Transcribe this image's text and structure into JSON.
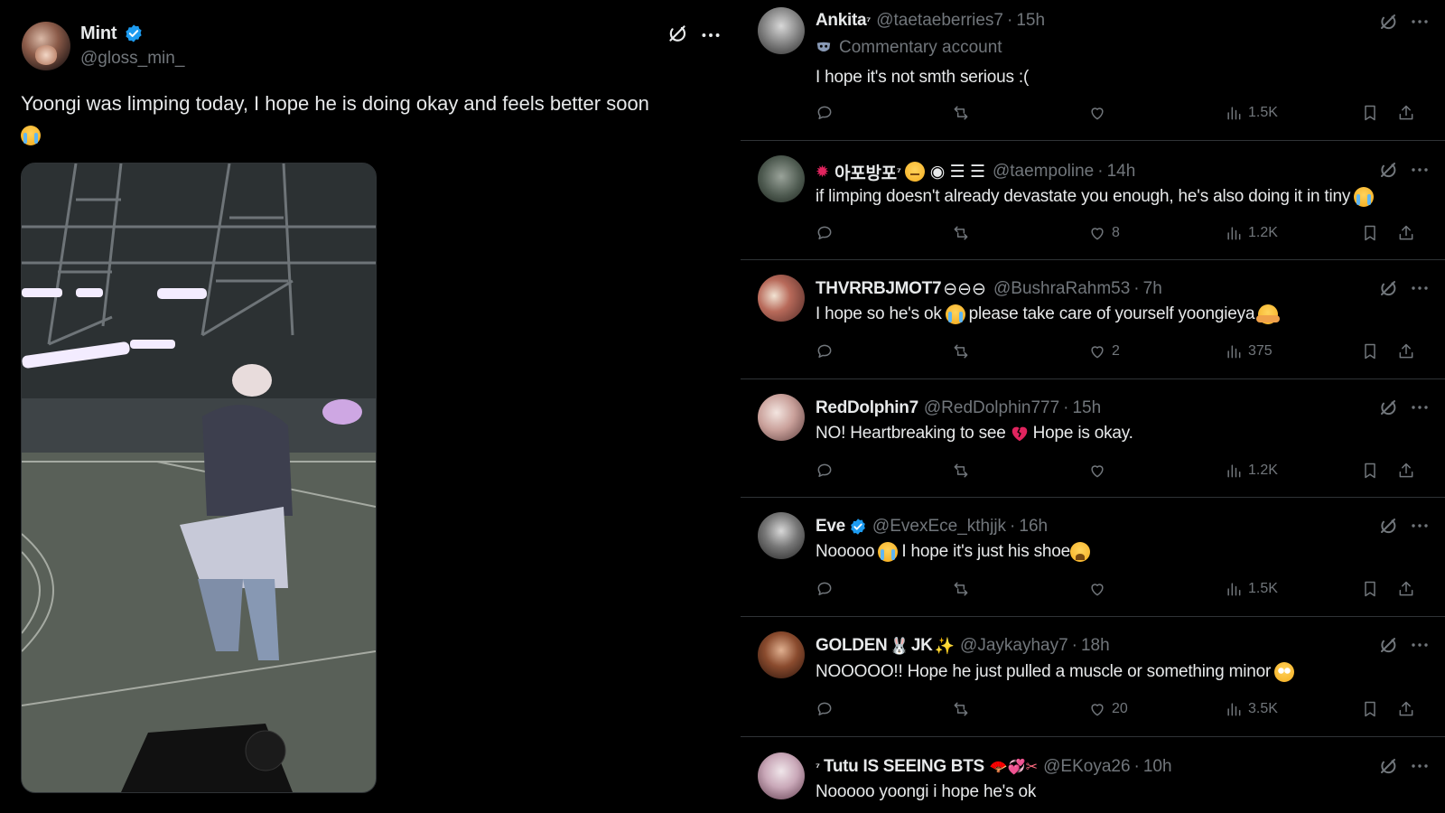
{
  "main_post": {
    "name": "Mint",
    "handle": "@gloss_min_",
    "text": "Yoongi was limping today, I hope he is doing okay and feels better soon",
    "verified": true
  },
  "replies": [
    {
      "name": "Ankita",
      "name_suffix": "⁷",
      "handle": "@taetaeberries7",
      "time": "15h",
      "sub_label": "Commentary account",
      "text": "I hope it's not smth serious :(",
      "likes": "",
      "views": "1.5K"
    },
    {
      "name": "아포방포",
      "name_suffix": "⁷",
      "handle": "@taempoline",
      "time": "14h",
      "text": "if limping doesn't already devastate you enough, he's also doing it in tiny",
      "likes": "8",
      "views": "1.2K"
    },
    {
      "name": "THVRRBJMOT7",
      "handle": "@BushraRahm53",
      "time": "7h",
      "text_a": "I hope so he's ok",
      "text_b": "please take care of yourself yoongieya",
      "likes": "2",
      "views": "375"
    },
    {
      "name": "RedDolphin7",
      "handle": "@RedDolphin777",
      "time": "15h",
      "text_a": "NO! Heartbreaking to see",
      "text_b": "Hope is okay.",
      "likes": "",
      "views": "1.2K"
    },
    {
      "name": "Eve",
      "handle": "@EvexEce_kthjjk",
      "time": "16h",
      "verified": true,
      "text_a": "Nooooo",
      "text_b": "I hope it's just his shoe",
      "likes": "",
      "views": "1.5K"
    },
    {
      "name": "GOLDEN",
      "name_b": "JK",
      "handle": "@Jaykayhay7",
      "time": "18h",
      "text": "NOOOOO!! Hope he just pulled a muscle or something minor",
      "likes": "20",
      "views": "3.5K"
    },
    {
      "name_prefix": "⁷",
      "name": "Tutu IS SEEING BTS",
      "handle": "@EKoya26",
      "time": "10h",
      "text": "Nooooo yoongi i hope he's ok"
    }
  ],
  "icons": {
    "verified": "verified-badge-icon",
    "grok": "grok-icon",
    "more": "more-icon",
    "reply": "reply-icon",
    "repost": "repost-icon",
    "like": "like-icon",
    "views": "views-icon",
    "bookmark": "bookmark-icon",
    "share": "share-icon"
  },
  "colors": {
    "background": "#000000",
    "text": "#e7e9ea",
    "muted": "#71767b",
    "divider": "#2f3336",
    "verified": "#1d9bf0"
  }
}
